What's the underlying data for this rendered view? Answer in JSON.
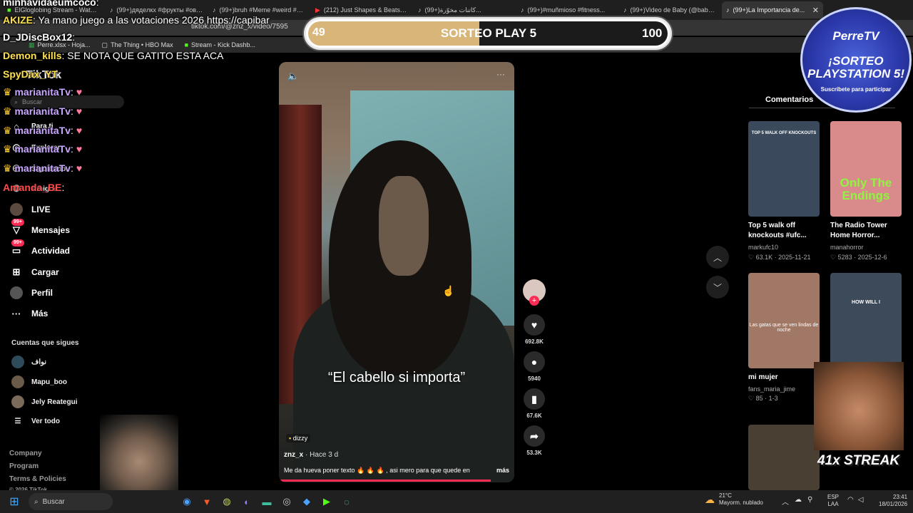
{
  "browser": {
    "tabs": [
      {
        "label": "ElGloglobing Stream - Watch L...",
        "icon": "kick-icon",
        "active": false
      },
      {
        "label": "(99+)дядeлкx #фрукты #ово...",
        "icon": "tiktok-icon",
        "active": false
      },
      {
        "label": "(99+)bruh #Meme #weird #cri...",
        "icon": "tiktok-icon",
        "active": false
      },
      {
        "label": "(212) Just Shapes & Beats - Of...",
        "icon": "youtube-icon",
        "active": false
      },
      {
        "label": "(99+)كاتنات مخوّرة... ",
        "icon": "tiktok-icon",
        "active": false
      },
      {
        "label": "(99+)#muñmioso #fitness...",
        "icon": "tiktok-icon",
        "active": false
      },
      {
        "label": "(99+)Video de Baby (@babyte...",
        "icon": "tiktok-icon",
        "active": false
      },
      {
        "label": "(99+)La Importancia de...",
        "icon": "tiktok-icon",
        "active": true
      }
    ],
    "url": "tiktok.com/@znz_x/video/7595",
    "bookmarks": [
      "Perre.xlsx - Hoja...",
      "The Thing • HBO Max",
      "Stream - Kick Dashb..."
    ]
  },
  "sidebar": {
    "brand": "TikTok",
    "search_placeholder": "Buscar",
    "nav": [
      {
        "label": "Para ti",
        "icon": "home-icon"
      },
      {
        "label": "Explorar",
        "icon": "compass-icon"
      },
      {
        "label": "Siguiendo",
        "icon": "following-icon"
      },
      {
        "label": "Amigos",
        "icon": "friends-icon"
      },
      {
        "label": "LIVE",
        "icon": "live-icon"
      },
      {
        "label": "Mensajes",
        "icon": "message-icon",
        "badge": "99+"
      },
      {
        "label": "Actividad",
        "icon": "activity-icon",
        "badge": "99+"
      },
      {
        "label": "Cargar",
        "icon": "upload-icon"
      },
      {
        "label": "Perfil",
        "icon": "profile-icon"
      },
      {
        "label": "Más",
        "icon": "more-icon"
      }
    ],
    "following_header": "Cuentas que sigues",
    "following": [
      "نواف",
      "Mapu_boo",
      "Jely Reategui"
    ],
    "see_all": "Ver todo",
    "footer": [
      "Company",
      "Program",
      "Terms & Policies",
      "© 2026 TikTok"
    ]
  },
  "video": {
    "caption": "“El cabello si importa”",
    "music": "dizzy",
    "author": "znz_x",
    "time": "· Hace 3 d",
    "description": "Me da hueva poner texto 🔥 🔥 🔥 , asi mero para que quede en",
    "more": "más",
    "progress": 0.9
  },
  "actions": {
    "likes": "692.8K",
    "comments": "5940",
    "saves": "67.6K",
    "shares": "53.3K"
  },
  "right_panel": {
    "tab": "Comentarios",
    "items": [
      {
        "title": "Top 5 walk off knockouts #ufc...",
        "author": "markufc10",
        "likes": "63.1K",
        "date": "2025-11-21",
        "thumb_text": "TOP 5 WALK OFF KNOCKOUTS",
        "bg": "#3a4a5c"
      },
      {
        "title": "The Radio Tower Home Horror...",
        "author": "manahorror",
        "likes": "5283",
        "date": "2025-12-6",
        "thumb_text": "Only The Endings",
        "bg": "#d98a8a"
      },
      {
        "title": "mi mujer",
        "author": "fans_maria_jime",
        "likes": "85",
        "date": "1-3",
        "thumb_text": "Las gatas que se ven lindas de noche",
        "bg": "#a17866"
      },
      {
        "title": "",
        "author": "",
        "likes": "",
        "date": "",
        "thumb_text": "HOW WILL I",
        "bg": "#3c4a5a"
      }
    ]
  },
  "overlay": {
    "poll_left": "49",
    "poll_title": "SORTEO PLAY 5",
    "poll_right": "100",
    "logo_name": "PerreTV",
    "logo_title": "¡SORTEO PLAYSTATION 5!",
    "logo_sub": "Suscríbete para participar",
    "streak": "41x STREAK",
    "chat": [
      {
        "user": "minhavidaeumcoco",
        "msg": "",
        "color": "#ffffff"
      },
      {
        "user": "AKIZE",
        "msg": "Ya mano juego a las votaciones 2026 https://capibar",
        "color": "#ffe14d"
      },
      {
        "user": "D_JDiscBox12",
        "msg": "",
        "color": "#ffffff"
      },
      {
        "user": "Demon_kills",
        "msg": "SE NOTA QUE GATITO ESTA ACA",
        "color": "#ffe14d"
      },
      {
        "user": "SpyDax_YT",
        "msg": "",
        "color": "#ffe14d"
      },
      {
        "user": "marianitaTv",
        "msg": "",
        "color": "#c9a7ff"
      },
      {
        "user": "marianitaTv",
        "msg": "",
        "color": "#c9a7ff"
      },
      {
        "user": "marianitaTv",
        "msg": "",
        "color": "#c9a7ff"
      },
      {
        "user": "marianitaTv",
        "msg": "",
        "color": "#c9a7ff"
      },
      {
        "user": "marianitaTv",
        "msg": "",
        "color": "#c9a7ff"
      },
      {
        "user": "Amanda_BE",
        "msg": "",
        "color": "#ff4a4a"
      }
    ]
  },
  "taskbar": {
    "search": "Buscar",
    "weather_temp": "21°C",
    "weather_desc": "Mayorm. nublado",
    "lang1": "ESP",
    "lang2": "LAA",
    "time": "23:41",
    "date": "18/01/2026"
  },
  "colors": {
    "accent": "#fe2c55",
    "poll_fill": "#d8b67a"
  }
}
